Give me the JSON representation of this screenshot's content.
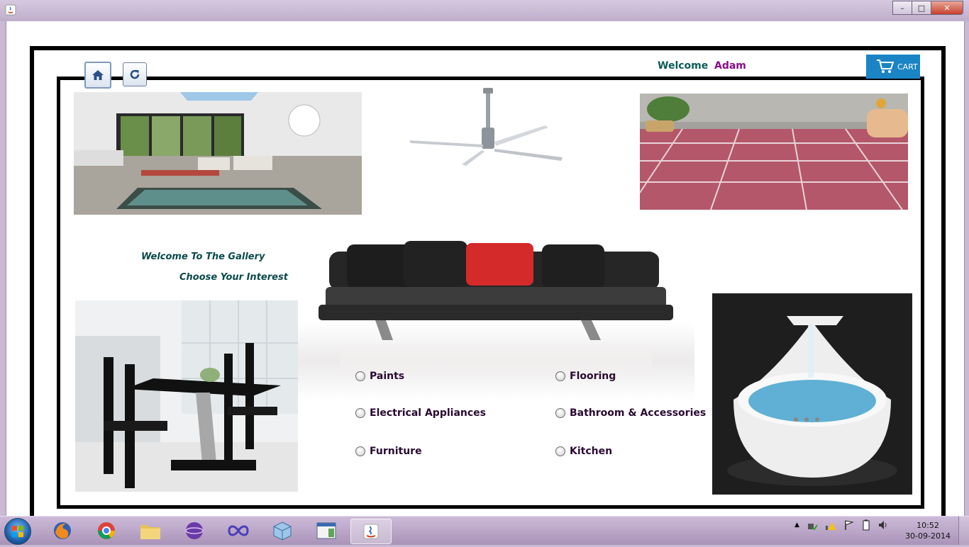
{
  "window": {
    "controls": [
      "–",
      "□",
      "✕"
    ]
  },
  "header": {
    "welcome_label": "Welcome",
    "user_name": "Adam",
    "cart_label": "CART",
    "colors": {
      "welcome": "#0a5c57",
      "user": "#8a0c8a",
      "cart": "#1a84c5"
    }
  },
  "toolbar": {
    "home_icon": "home-icon",
    "refresh_icon": "refresh-icon"
  },
  "gallery": {
    "welcome_text": "Welcome To The Gallery",
    "choose_text": "Choose Your Interest"
  },
  "options": [
    {
      "label": "Paints",
      "selected": false
    },
    {
      "label": "Flooring",
      "selected": false
    },
    {
      "label": "Electrical Appliances",
      "selected": false
    },
    {
      "label": "Bathroom & Accessories",
      "selected": false
    },
    {
      "label": "Furniture",
      "selected": false
    },
    {
      "label": "Kitchen",
      "selected": false
    }
  ],
  "images": {
    "living_room": "living-room-photo",
    "ceiling_fan": "ceiling-fan-photo",
    "tiled_floor": "tiled-floor-photo",
    "sofa": "sofa-photo",
    "dining_set": "dining-set-photo",
    "bathtub": "bathtub-photo"
  },
  "taskbar": {
    "apps": [
      "firefox-icon",
      "chrome-icon",
      "folder-icon",
      "media-icon",
      "infinity-icon",
      "cube-icon",
      "window-icon",
      "java-icon"
    ],
    "time": "10:52",
    "date": "30-09-2014"
  }
}
